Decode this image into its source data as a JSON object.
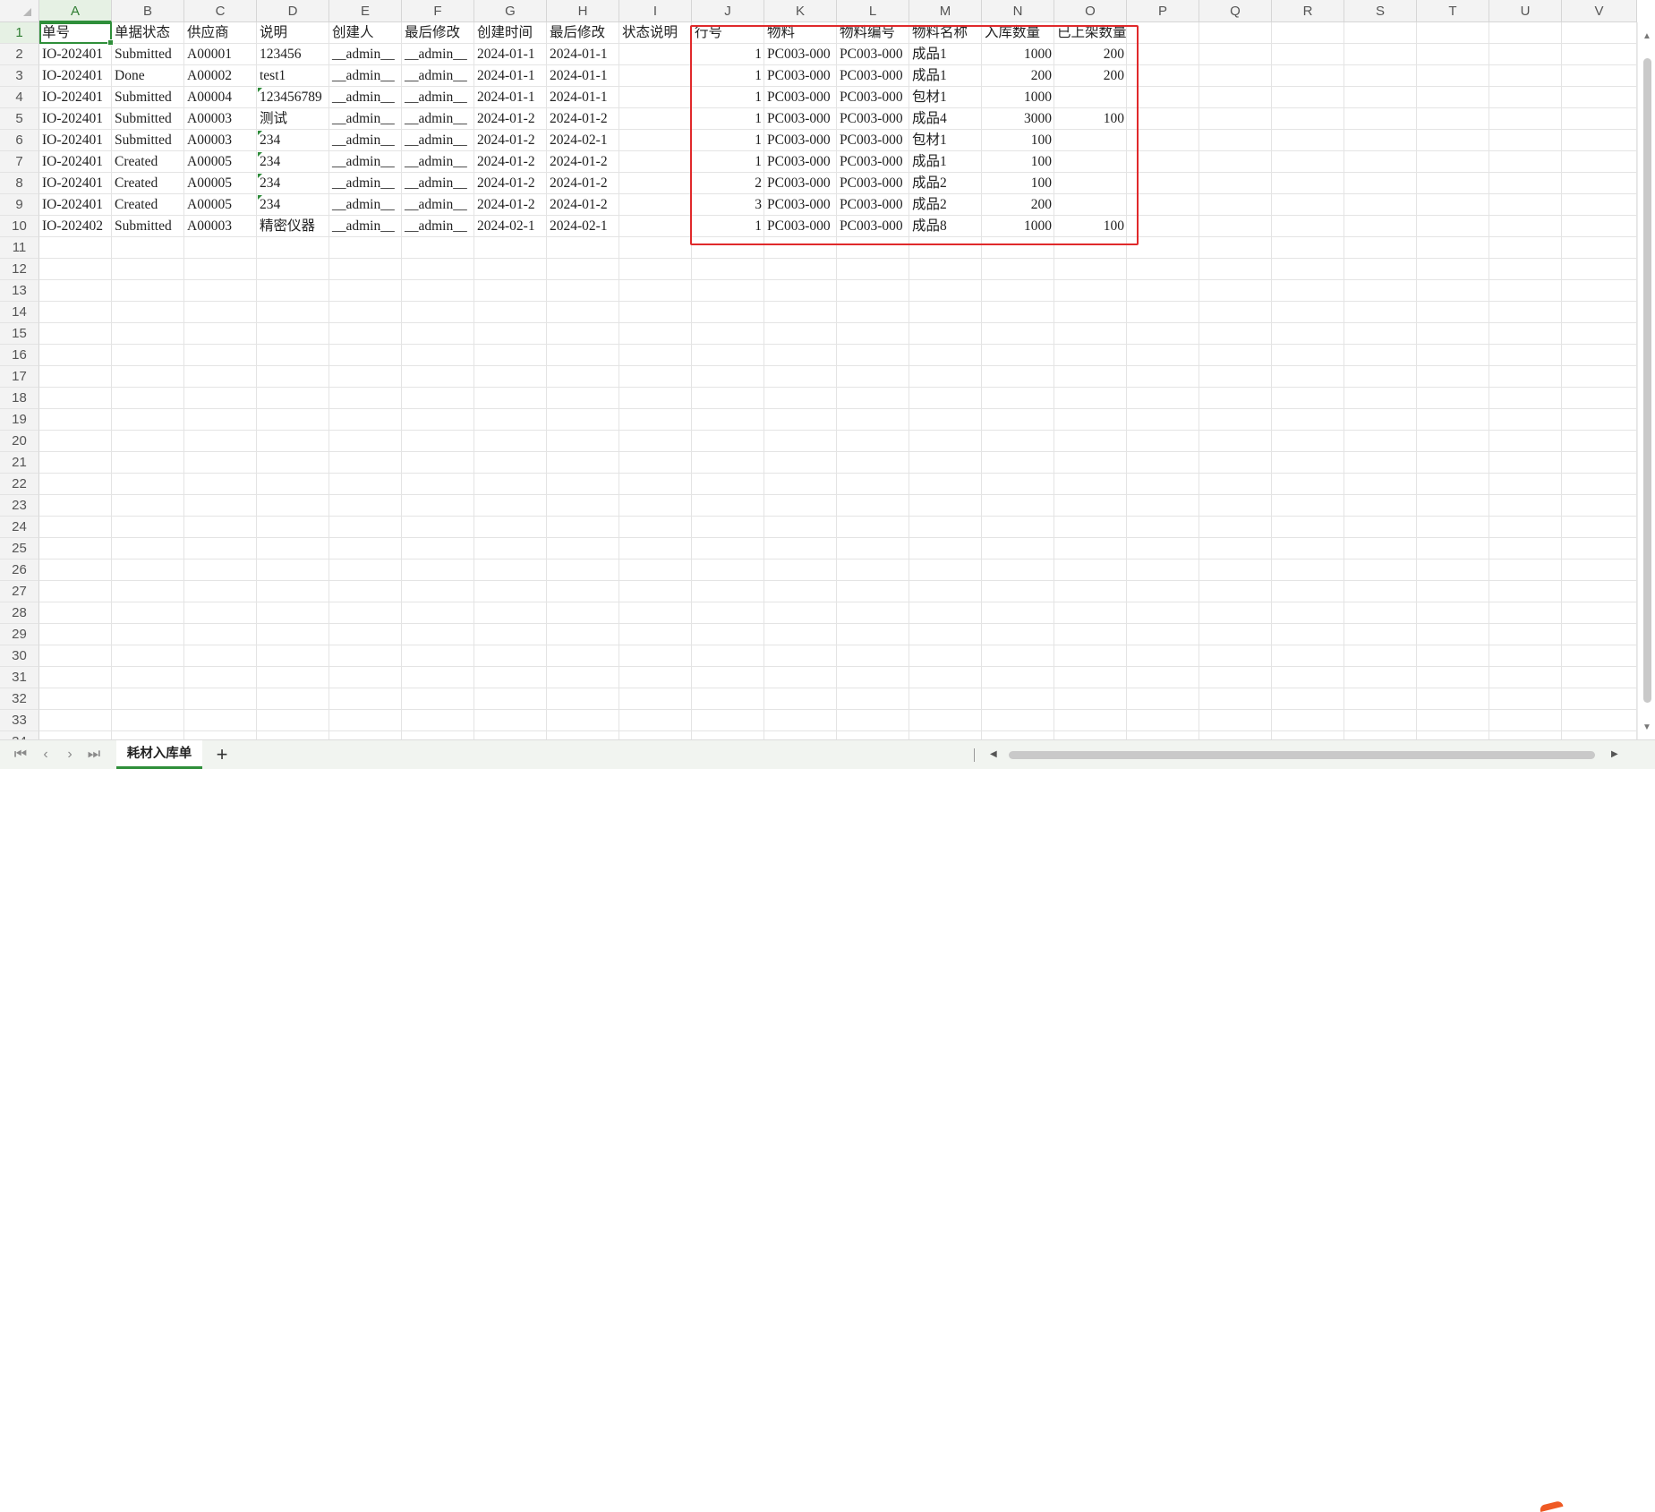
{
  "sheet": {
    "columns": [
      "A",
      "B",
      "C",
      "D",
      "E",
      "F",
      "G",
      "H",
      "I",
      "J",
      "K",
      "L",
      "M",
      "N",
      "O",
      "P",
      "Q",
      "R",
      "S",
      "T",
      "U",
      "V"
    ],
    "visible_rows": 34,
    "selected_cell": "A1",
    "rows": [
      [
        "单号",
        "单据状态",
        "供应商",
        "说明",
        "创建人",
        "最后修改",
        "创建时间",
        "最后修改",
        "状态说明",
        "行号",
        "物料",
        "物料编号",
        "物料名称",
        "入库数量",
        "已上架数量"
      ],
      [
        "IO-202401",
        "Submitted",
        "A00001",
        "123456",
        "__admin__",
        "__admin__",
        "2024-01-1",
        "2024-01-1",
        "",
        "1",
        "PC003-000",
        "PC003-000",
        "成品1",
        "1000",
        "200"
      ],
      [
        "IO-202401",
        "Done",
        "A00002",
        "test1",
        "__admin__",
        "__admin__",
        "2024-01-1",
        "2024-01-1",
        "",
        "1",
        "PC003-000",
        "PC003-000",
        "成品1",
        "200",
        "200"
      ],
      [
        "IO-202401",
        "Submitted",
        "A00004",
        "123456789",
        "__admin__",
        "__admin__",
        "2024-01-1",
        "2024-01-1",
        "",
        "1",
        "PC003-000",
        "PC003-000",
        "包材1",
        "1000",
        ""
      ],
      [
        "IO-202401",
        "Submitted",
        "A00003",
        "测试",
        "__admin__",
        "__admin__",
        "2024-01-2",
        "2024-01-2",
        "",
        "1",
        "PC003-000",
        "PC003-000",
        "成品4",
        "3000",
        "100"
      ],
      [
        "IO-202401",
        "Submitted",
        "A00003",
        "234",
        "__admin__",
        "__admin__",
        "2024-01-2",
        "2024-02-1",
        "",
        "1",
        "PC003-000",
        "PC003-000",
        "包材1",
        "100",
        ""
      ],
      [
        "IO-202401",
        "Created",
        "A00005",
        "234",
        "__admin__",
        "__admin__",
        "2024-01-2",
        "2024-01-2",
        "",
        "1",
        "PC003-000",
        "PC003-000",
        "成品1",
        "100",
        ""
      ],
      [
        "IO-202401",
        "Created",
        "A00005",
        "234",
        "__admin__",
        "__admin__",
        "2024-01-2",
        "2024-01-2",
        "",
        "2",
        "PC003-000",
        "PC003-000",
        "成品2",
        "100",
        ""
      ],
      [
        "IO-202401",
        "Created",
        "A00005",
        "234",
        "__admin__",
        "__admin__",
        "2024-01-2",
        "2024-01-2",
        "",
        "3",
        "PC003-000",
        "PC003-000",
        "成品2",
        "200",
        ""
      ],
      [
        "IO-202402",
        "Submitted",
        "A00003",
        "精密仪器",
        "__admin__",
        "__admin__",
        "2024-02-1",
        "2024-02-1",
        "",
        "1",
        "PC003-000",
        "PC003-000",
        "成品8",
        "1000",
        "100"
      ]
    ],
    "numeric_columns": [
      "J",
      "N",
      "O"
    ],
    "error_marker_cells": [
      "D4",
      "D6",
      "D7",
      "D8",
      "D9"
    ]
  },
  "tabbar": {
    "nav_first": "⏮",
    "nav_prev": "‹",
    "nav_next": "›",
    "nav_last": "⏭",
    "sheet_tab": "耗材入库单",
    "add_sheet": "+"
  },
  "scroll": {
    "up_arrow": "▲",
    "down_arrow": "▼",
    "left_arrow": "◀",
    "right_arrow": "▶"
  },
  "colors": {
    "accent": "#2f8f3a",
    "highlight_box": "#e0292b"
  }
}
